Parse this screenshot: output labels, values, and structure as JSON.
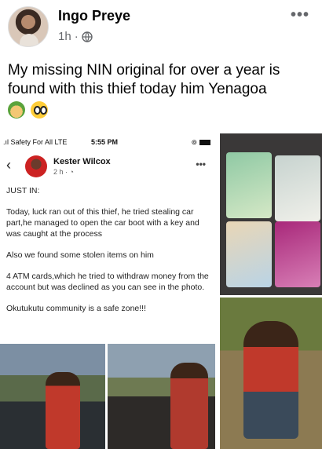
{
  "post": {
    "author": "Ingo Preye",
    "time": "1h",
    "meta_separator": "·",
    "more_icon": "more-icon",
    "text": "My missing NIN original for over a year is found with this thief today him Yenagoa",
    "emojis": [
      "farmer-emoji",
      "flushed-face-emoji"
    ]
  },
  "screenshot": {
    "status": {
      "carrier": "Safety For All  LTE",
      "time": "5:55 PM"
    },
    "header": {
      "name": "Kester Wilcox",
      "time": "2 h · ",
      "back_icon": "chevron-left-icon",
      "more_icon": "more-icon"
    },
    "paragraphs": [
      "JUST IN:",
      "Today, luck ran out of this thief, he tried stealing car part,he managed to open the car boot with a key and was caught at the process",
      "Also we found some stolen items on him",
      " 4 ATM cards,which he tried to withdraw money from the account but was declined as you can see in the photo.",
      "Okutukutu community is a safe zone!!!"
    ]
  },
  "photos": [
    "car-boot-photo-left",
    "car-boot-photo-right",
    "id-cards-photo",
    "suspect-photo"
  ]
}
